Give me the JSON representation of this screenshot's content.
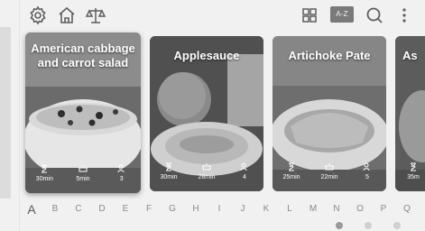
{
  "toolbar": {
    "settings_icon": "gear-icon",
    "home_icon": "home-icon",
    "scale_icon": "balance-scale-icon",
    "grid_icon": "grid-view-icon",
    "sort_label": "A-Z",
    "search_icon": "search-icon",
    "more_icon": "more-vertical-icon"
  },
  "recipes": [
    {
      "title": "American cabbage and carrot salad",
      "time": "30min",
      "cook_time": "5min",
      "servings": "3"
    },
    {
      "title": "Applesauce",
      "time": "30min",
      "cook_time": "28min",
      "servings": "4"
    },
    {
      "title": "Artichoke Pate",
      "time": "25min",
      "cook_time": "22min",
      "servings": "5"
    },
    {
      "title": "As",
      "time": "35m",
      "cook_time": "",
      "servings": ""
    }
  ],
  "alphabet": [
    "A",
    "B",
    "C",
    "D",
    "E",
    "F",
    "G",
    "H",
    "I",
    "J",
    "K",
    "L",
    "M",
    "N",
    "O",
    "P",
    "Q"
  ],
  "pager": {
    "pages": 3,
    "active_page": 1
  }
}
